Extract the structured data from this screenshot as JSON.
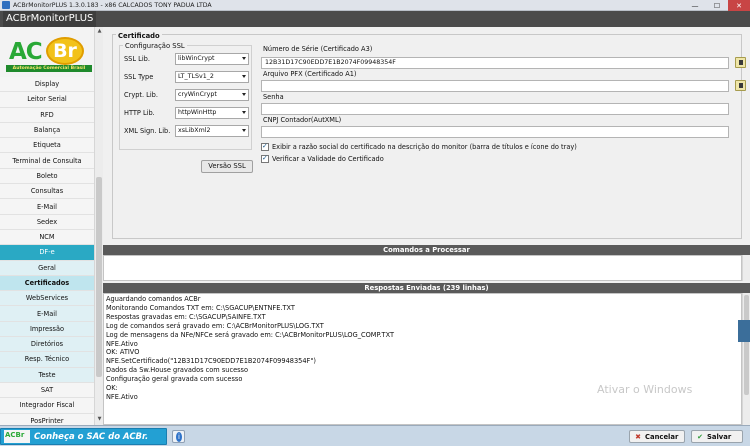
{
  "window": {
    "title": "ACBrMonitorPLUS 1.3.0.183 - x86   CALCADOS TONY PADUA LTDA",
    "app_name": "ACBrMonitorPLUS",
    "minimize": "—",
    "maximize": "☐",
    "close": "✕"
  },
  "logo": {
    "ac": "AC",
    "br": "Br",
    "tagline": "Automação Comercial Brasil"
  },
  "sidebar": {
    "scroll_up": "▲",
    "scroll_down": "▼",
    "items": [
      {
        "label": "Display"
      },
      {
        "label": "Leitor Serial"
      },
      {
        "label": "RFD"
      },
      {
        "label": "Balança"
      },
      {
        "label": "Etiqueta"
      },
      {
        "label": "Terminal de Consulta"
      },
      {
        "label": "Boleto"
      },
      {
        "label": "Consultas"
      },
      {
        "label": "E-Mail"
      },
      {
        "label": "Sedex"
      },
      {
        "label": "NCM"
      },
      {
        "label": "DF-e"
      },
      {
        "label": "Geral"
      },
      {
        "label": "Certificados"
      },
      {
        "label": "WebServices"
      },
      {
        "label": "E-Mail"
      },
      {
        "label": "Impressão"
      },
      {
        "label": "Diretórios"
      },
      {
        "label": "Resp. Técnico"
      },
      {
        "label": "Teste"
      },
      {
        "label": "SAT"
      },
      {
        "label": "Integrador Fiscal"
      },
      {
        "label": "PosPrinter"
      }
    ]
  },
  "certificado": {
    "group_title": "Certificado",
    "ssl_group_title": "Configuração SSL",
    "ssl_lib_label": "SSL Lib.",
    "ssl_lib_value": "libWinCrypt",
    "ssl_type_label": "SSL Type",
    "ssl_type_value": "LT_TLSv1_2",
    "crypt_lib_label": "Crypt. Lib.",
    "crypt_lib_value": "cryWinCrypt",
    "http_lib_label": "HTTP Lib.",
    "http_lib_value": "httpWinHttp",
    "xml_sign_label": "XML Sign. Lib.",
    "xml_sign_value": "xsLibXml2",
    "versao_ssl_button": "Versão SSL",
    "numero_serie_label": "Número de Série (Certificado A3)",
    "numero_serie_value": "12B31D17C90EDD7E1B2074F09948354F",
    "arquivo_pfx_label": "Arquivo PFX (Certificado A1)",
    "arquivo_pfx_value": "",
    "senha_label": "Senha",
    "senha_value": "",
    "cnpj_label": "CNPJ Contador(AutXML)",
    "cnpj_value": "",
    "exibir_razao_label": "Exibir a razão social do certificado na descrição do monitor (barra de títulos e ícone do tray)",
    "exibir_razao_checked": true,
    "verificar_validade_label": "Verificar a Validade do Certificado",
    "verificar_validade_checked": true
  },
  "comandos": {
    "title": "Comandos a Processar"
  },
  "respostas": {
    "title": "Respostas Enviadas (239 linhas)",
    "lines": [
      "Aguardando comandos ACBr",
      "Monitorando Comandos TXT em: C:\\SGACUP\\ENTNFE.TXT",
      "Respostas gravadas em: C:\\SGACUP\\SAINFE.TXT",
      "Log de comandos será gravado em: C:\\ACBrMonitorPLUS\\LOG.TXT",
      "Log de mensagens da NFe/NFCe será gravado em: C:\\ACBrMonitorPLUS\\LOG_COMP.TXT",
      "NFE.Ativo",
      "OK: ATIVO",
      "NFE.SetCertificado(\"12B31D17C90EDD7E1B2074F09948354F\")",
      "Dados da Sw.House gravados com sucesso",
      "Configuração geral gravada com sucesso",
      "OK:",
      "NFE.Ativo"
    ]
  },
  "watermark": "Ativar o Windows",
  "bottom": {
    "banner_text": "Conheça o SAC do ACBr.",
    "cancel_button": "Cancelar",
    "save_button": "Salvar",
    "cancel_icon": "✖",
    "save_icon": "✔"
  }
}
